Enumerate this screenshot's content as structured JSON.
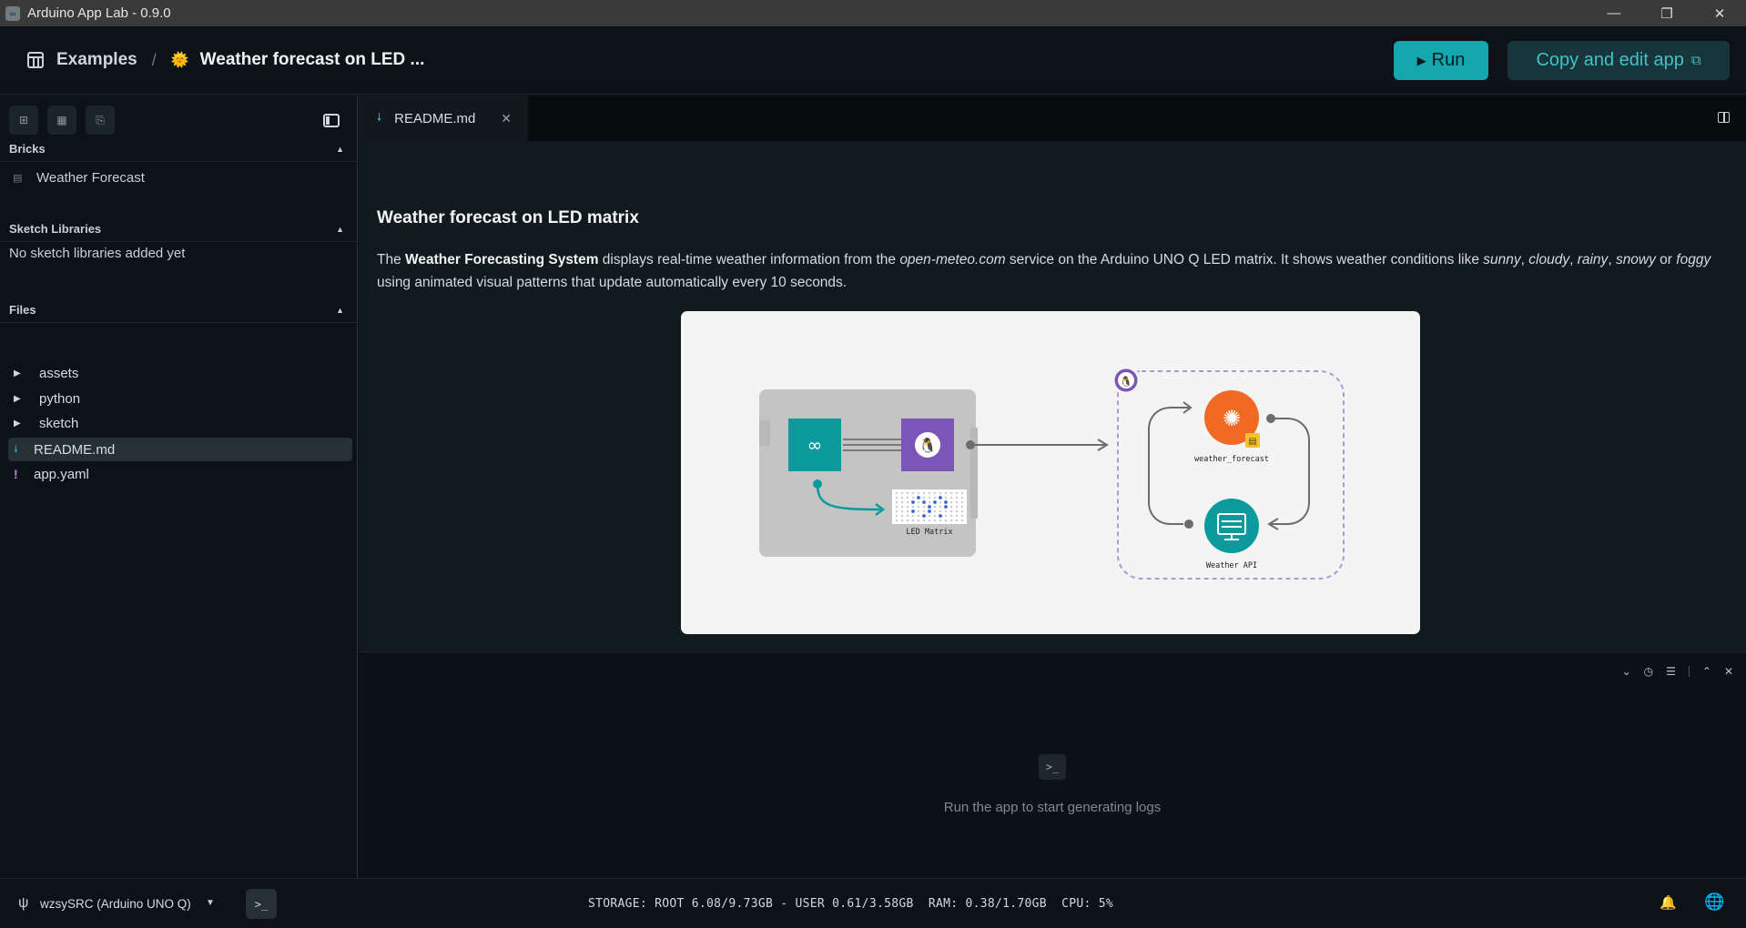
{
  "window": {
    "title": "Arduino App Lab - 0.9.0",
    "icon": "arduino-infinity-icon",
    "controls": [
      "minimize",
      "restore",
      "close"
    ]
  },
  "header": {
    "breadcrumb_root": "Examples",
    "breadcrumb_separator": "/",
    "breadcrumb_emoji": "🌞",
    "breadcrumb_current": "Weather forecast on LED ...",
    "run_label": "Run",
    "copy_label": "Copy and edit app",
    "accent": "#14a7ad"
  },
  "sidebar": {
    "bricks": {
      "title": "Bricks",
      "items": [
        {
          "label": "Weather Forecast",
          "icon": "brick-icon"
        }
      ]
    },
    "sketch_libraries": {
      "title": "Sketch Libraries",
      "empty": "No sketch libraries added yet"
    },
    "files": {
      "title": "Files",
      "items": [
        {
          "label": "assets",
          "type": "folder"
        },
        {
          "label": "python",
          "type": "folder"
        },
        {
          "label": "sketch",
          "type": "folder"
        },
        {
          "label": "README.md",
          "type": "markdown",
          "active": true
        },
        {
          "label": "app.yaml",
          "type": "yaml"
        }
      ]
    }
  },
  "editor": {
    "tab_label": "README.md"
  },
  "readme": {
    "title": "Weather forecast on LED matrix",
    "p_the": "The ",
    "p_bold": "Weather Forecasting System",
    "p_mid1": " displays real-time weather information from the ",
    "p_em_source": "open-meteo.com",
    "p_mid2": " service on the Arduino UNO Q LED matrix. It shows weather conditions like ",
    "p_em_sunny": "sunny",
    "p_em_cloudy": "cloudy",
    "p_em_rainy": "rainy",
    "p_em_snowy": "snowy",
    "p_or": " or ",
    "p_em_foggy": "foggy",
    "p_end": " using animated visual patterns that update automatically every 10 seconds.",
    "comma": ", ",
    "diagram": {
      "led_label": "LED Matrix",
      "brick_label": "weather_forecast",
      "api_label": "Weather API"
    }
  },
  "logs": {
    "empty_message": "Run the app to start generating logs"
  },
  "status": {
    "device": "wzsySRC (Arduino UNO Q)",
    "stats": "STORAGE: ROOT 6.08/9.73GB - USER 0.61/3.58GB  RAM: 0.38/1.70GB  CPU: 5%"
  }
}
